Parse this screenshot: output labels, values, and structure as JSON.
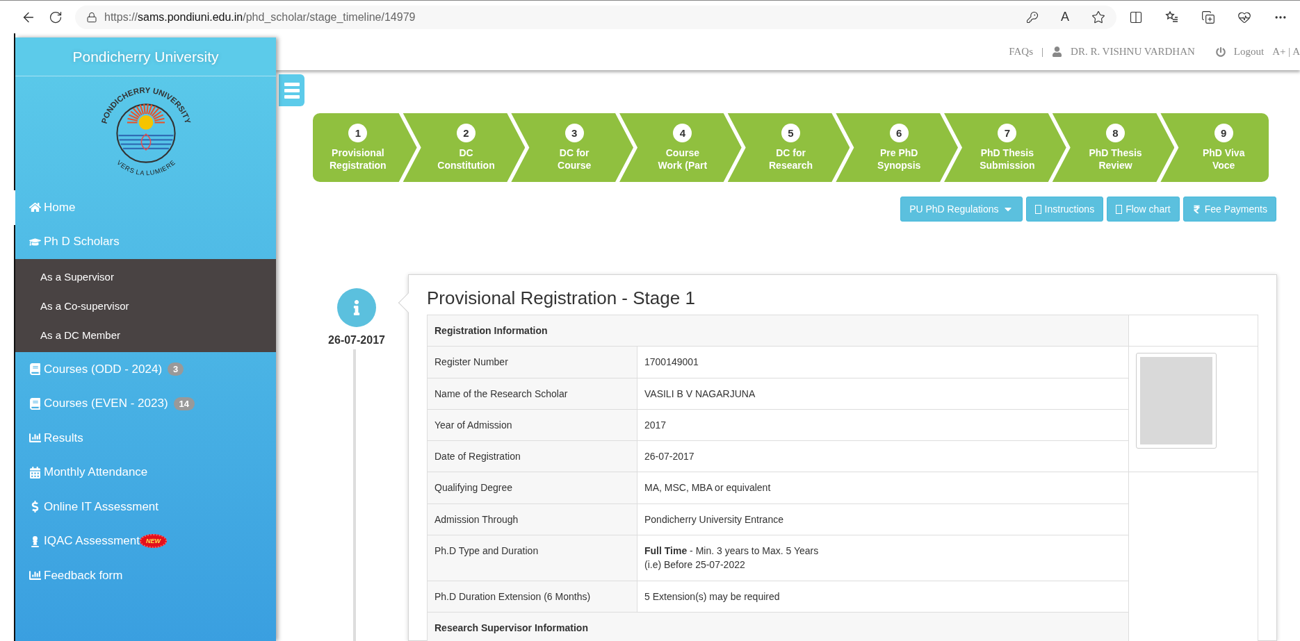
{
  "browser": {
    "url": {
      "scheme": "https://",
      "host": "sams.pondiuni.edu.in",
      "path": "/phd_scholar/stage_timeline/14979"
    },
    "read_aloud_glyph": "A"
  },
  "sidebar": {
    "title": "Pondicherry University",
    "logo": {
      "top_text": "PONDICHERRY UNIVERSITY",
      "bottom_text": "VERS LA LUMIERE"
    },
    "items": [
      {
        "label": "Home",
        "selected": true
      },
      {
        "label": "Ph D Scholars",
        "selected": false,
        "expanded": true,
        "children": [
          {
            "label": "As a Supervisor"
          },
          {
            "label": "As a Co-supervisor"
          },
          {
            "label": "As a DC Member"
          }
        ]
      },
      {
        "label": "Courses (ODD - 2024)",
        "badge": "3",
        "selected": false
      },
      {
        "label": "Courses (EVEN - 2023)",
        "badge": "14",
        "selected": false
      },
      {
        "label": "Results",
        "selected": false
      },
      {
        "label": "Monthly Attendance",
        "selected": false
      },
      {
        "label": "Online IT Assessment",
        "selected": false
      },
      {
        "label": "IQAC Assessment",
        "tag": "NEW",
        "selected": false
      },
      {
        "label": "Feedback form",
        "selected": false
      }
    ]
  },
  "header": {
    "faqs": "FAQs",
    "separator": "|",
    "user": "DR. R. VISHNU VARDHAN",
    "logout": "Logout",
    "text_size": "A+ | A"
  },
  "stages": [
    {
      "number": "1",
      "lines": [
        "Provisional",
        "Registration"
      ]
    },
    {
      "number": "2",
      "lines": [
        "DC",
        "Constitution"
      ]
    },
    {
      "number": "3",
      "lines": [
        "DC for",
        "Course"
      ]
    },
    {
      "number": "4",
      "lines": [
        "Course",
        "Work (Part"
      ]
    },
    {
      "number": "5",
      "lines": [
        "DC for",
        "Research"
      ]
    },
    {
      "number": "6",
      "lines": [
        "Pre PhD",
        "Synopsis"
      ]
    },
    {
      "number": "7",
      "lines": [
        "PhD Thesis",
        "Submission"
      ]
    },
    {
      "number": "8",
      "lines": [
        "PhD Thesis",
        "Review"
      ]
    },
    {
      "number": "9",
      "lines": [
        "PhD Viva",
        "Voce"
      ]
    }
  ],
  "buttons": [
    {
      "label": "PU PhD Regulations",
      "kind": "dropdown"
    },
    {
      "label": "Instructions",
      "kind": "document"
    },
    {
      "label": "Flow chart",
      "kind": "document"
    },
    {
      "label": "Fee Payments",
      "kind": "fee"
    }
  ],
  "timeline": {
    "date": "26-07-2017",
    "title": "Provisional Registration - Stage 1",
    "rows": [
      {
        "kind": "section",
        "label": "Registration Information"
      },
      {
        "kind": "field",
        "label": "Register Number",
        "value": [
          "1700149001"
        ]
      },
      {
        "kind": "field",
        "label": "Name of the Research Scholar",
        "value": [
          "VASILI B V NAGARJUNA"
        ]
      },
      {
        "kind": "field",
        "label": "Year of Admission",
        "value": [
          "2017"
        ]
      },
      {
        "kind": "field",
        "label": "Date of Registration",
        "value": [
          "26-07-2017"
        ]
      },
      {
        "kind": "field",
        "label": "Qualifying Degree",
        "value": [
          "MA, MSC, MBA or equivalent"
        ]
      },
      {
        "kind": "field",
        "label": "Admission Through",
        "value": [
          "Pondicherry University Entrance"
        ]
      },
      {
        "kind": "field",
        "label": "Ph.D Type and Duration",
        "value": [
          "**Full Time** - Min. 3 years to Max. 5 Years",
          "(i.e) Before 25-07-2022"
        ]
      },
      {
        "kind": "field",
        "label": "Ph.D Duration Extension (6 Months)",
        "value": [
          "5 Extension(s) may be required"
        ]
      },
      {
        "kind": "section",
        "label": "Research Supervisor Information"
      }
    ]
  }
}
